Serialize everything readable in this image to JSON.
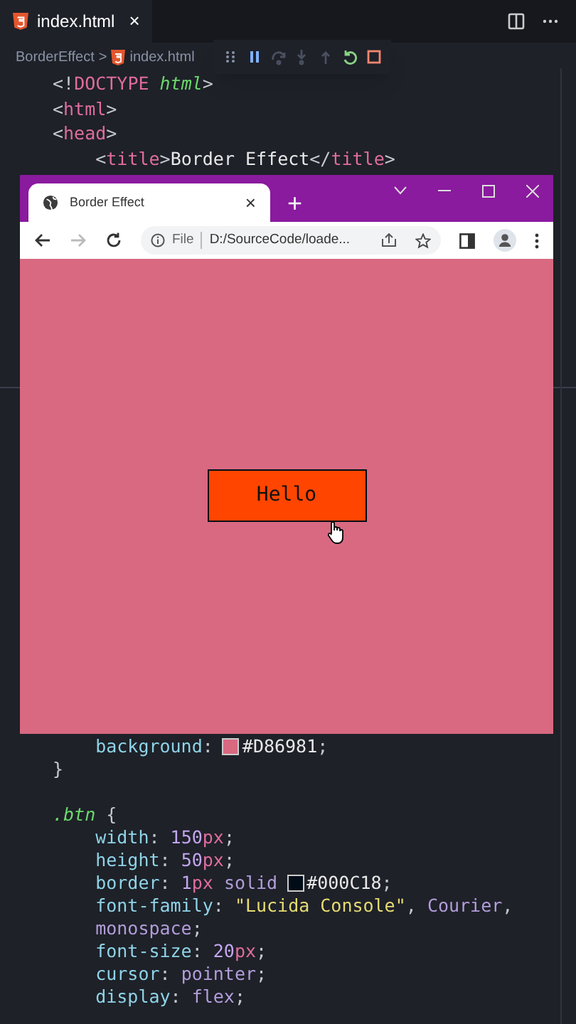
{
  "editor": {
    "tabs": [
      {
        "label": "index.html",
        "close": "×",
        "selected": true
      }
    ],
    "breadcrumbs": {
      "folder": "BorderEffect",
      "separator": ">",
      "file": "index.html"
    },
    "debug_toolbar": [
      {
        "kind": "grip",
        "disabled": false
      },
      {
        "kind": "pause",
        "disabled": false
      },
      {
        "kind": "step-over",
        "disabled": true
      },
      {
        "kind": "step-into",
        "disabled": true
      },
      {
        "kind": "step-out",
        "disabled": true
      },
      {
        "kind": "restart",
        "disabled": false
      },
      {
        "kind": "stop",
        "disabled": false
      }
    ],
    "code_top": [
      [
        {
          "kind": "p",
          "text": "<!"
        },
        {
          "kind": "kw",
          "text": "DOCTYPE"
        },
        {
          "kind": "attr",
          "text": " html"
        },
        {
          "kind": "p",
          "text": ">"
        }
      ],
      [
        {
          "kind": "p",
          "text": "<"
        },
        {
          "kind": "tag",
          "text": "html"
        },
        {
          "kind": "p",
          "text": ">"
        }
      ],
      [
        {
          "kind": "p",
          "text": "<"
        },
        {
          "kind": "tag",
          "text": "head"
        },
        {
          "kind": "p",
          "text": ">"
        }
      ],
      [
        {
          "kind": "p",
          "text": "    <"
        },
        {
          "kind": "tag",
          "text": "title"
        },
        {
          "kind": "p",
          "text": ">"
        },
        {
          "kind": "text",
          "text": "Border Effect"
        },
        {
          "kind": "p",
          "text": "</"
        },
        {
          "kind": "tag",
          "text": "title"
        },
        {
          "kind": "p",
          "text": ">"
        }
      ]
    ],
    "code_bottom": [
      [
        {
          "kind": "prop",
          "text": "    background"
        },
        {
          "kind": "p",
          "text": ": "
        },
        {
          "kind": "swatch",
          "color": "#d86981"
        },
        {
          "kind": "text",
          "text": "#D86981"
        },
        {
          "kind": "p",
          "text": ";"
        }
      ],
      [
        {
          "kind": "p",
          "text": "}"
        }
      ],
      [
        {
          "kind": "sel",
          "text": ".btn"
        },
        {
          "kind": "p",
          "text": " {"
        }
      ],
      [
        {
          "kind": "prop",
          "text": "    width"
        },
        {
          "kind": "p",
          "text": ": "
        },
        {
          "kind": "num",
          "text": "150"
        },
        {
          "kind": "unit",
          "text": "px"
        },
        {
          "kind": "p",
          "text": ";"
        }
      ],
      [
        {
          "kind": "prop",
          "text": "    height"
        },
        {
          "kind": "p",
          "text": ": "
        },
        {
          "kind": "num",
          "text": "50"
        },
        {
          "kind": "unit",
          "text": "px"
        },
        {
          "kind": "p",
          "text": ";"
        }
      ],
      [
        {
          "kind": "prop",
          "text": "    border"
        },
        {
          "kind": "p",
          "text": ": "
        },
        {
          "kind": "num",
          "text": "1"
        },
        {
          "kind": "unit",
          "text": "px"
        },
        {
          "kind": "val",
          "text": " solid "
        },
        {
          "kind": "swatch",
          "color": "#000c18"
        },
        {
          "kind": "text",
          "text": "#000C18"
        },
        {
          "kind": "p",
          "text": ";"
        }
      ],
      [
        {
          "kind": "prop",
          "text": "    font-family"
        },
        {
          "kind": "p",
          "text": ": "
        },
        {
          "kind": "str",
          "text": "\"Lucida Console\""
        },
        {
          "kind": "p",
          "text": ", "
        },
        {
          "kind": "val",
          "text": "Courier"
        },
        {
          "kind": "p",
          "text": ","
        }
      ],
      [
        {
          "kind": "val",
          "text": "    monospace"
        },
        {
          "kind": "p",
          "text": ";"
        }
      ],
      [
        {
          "kind": "prop",
          "text": "    font-size"
        },
        {
          "kind": "p",
          "text": ": "
        },
        {
          "kind": "num",
          "text": "20"
        },
        {
          "kind": "unit",
          "text": "px"
        },
        {
          "kind": "p",
          "text": ";"
        }
      ],
      [
        {
          "kind": "prop",
          "text": "    cursor"
        },
        {
          "kind": "p",
          "text": ": "
        },
        {
          "kind": "val",
          "text": "pointer"
        },
        {
          "kind": "p",
          "text": ";"
        }
      ],
      [
        {
          "kind": "prop",
          "text": "    display"
        },
        {
          "kind": "p",
          "text": ": "
        },
        {
          "kind": "val",
          "text": "flex"
        },
        {
          "kind": "p",
          "text": ";"
        }
      ]
    ]
  },
  "browser": {
    "tab": {
      "title": "Border Effect",
      "close": "×",
      "selected": true
    },
    "new_tab": "+",
    "nav": [
      {
        "kind": "back",
        "disabled": false
      },
      {
        "kind": "forward",
        "disabled": true
      },
      {
        "kind": "reload",
        "disabled": false
      }
    ],
    "site_info": "File",
    "address": "D:/SourceCode/loade...",
    "page": {
      "button": "Hello"
    }
  }
}
